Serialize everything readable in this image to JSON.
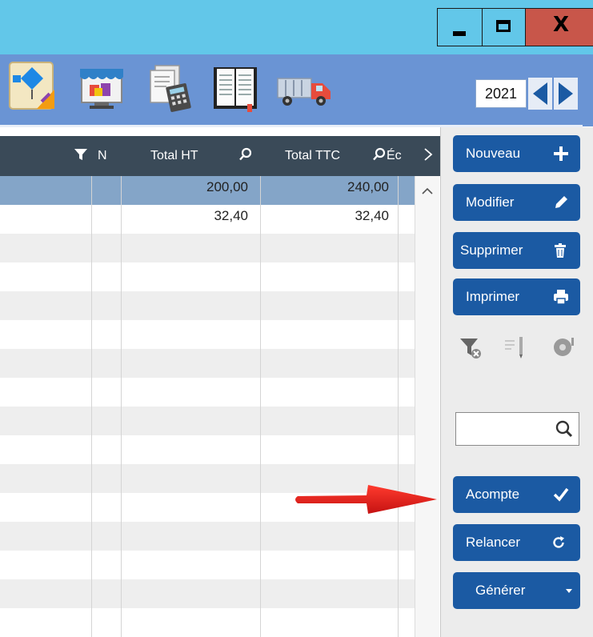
{
  "window": {
    "minimize_icon": "minimize-icon",
    "maximize_icon": "maximize-icon",
    "close_glyph": "X",
    "close_color": "#c8564a",
    "titlebar_color": "#62c7e9"
  },
  "toolbar": {
    "color": "#6a94d4",
    "tools": [
      "diagram-icon",
      "shop-icon",
      "invoice-calculator-icon",
      "book-icon",
      "truck-icon"
    ],
    "year": "2021"
  },
  "grid": {
    "columns": [
      {
        "label": "N",
        "filter_icon": "filter-icon"
      },
      {
        "label": "Total HT",
        "search_icon": "search-icon"
      },
      {
        "label": "Total TTC",
        "search_icon": "search-icon"
      },
      {
        "label": "Éc"
      }
    ],
    "rows": [
      {
        "total_ht": "200,00",
        "total_ttc": "240,00",
        "selected": true
      },
      {
        "total_ht": "32,40",
        "total_ttc": "32,40",
        "selected": false
      }
    ],
    "selected_color": "#84a5c8",
    "header_color": "#3a4a58"
  },
  "actions": {
    "nouveau": "Nouveau",
    "modifier": "Modifier",
    "supprimer": "Supprimer",
    "imprimer": "Imprimer",
    "acompte": "Acompte",
    "relancer": "Relancer",
    "generer": "Générer",
    "button_color": "#1b5aa3"
  },
  "side_search": {
    "value": "",
    "icon": "search-icon"
  },
  "annotation": {
    "arrow_color": "#e31b1b"
  }
}
